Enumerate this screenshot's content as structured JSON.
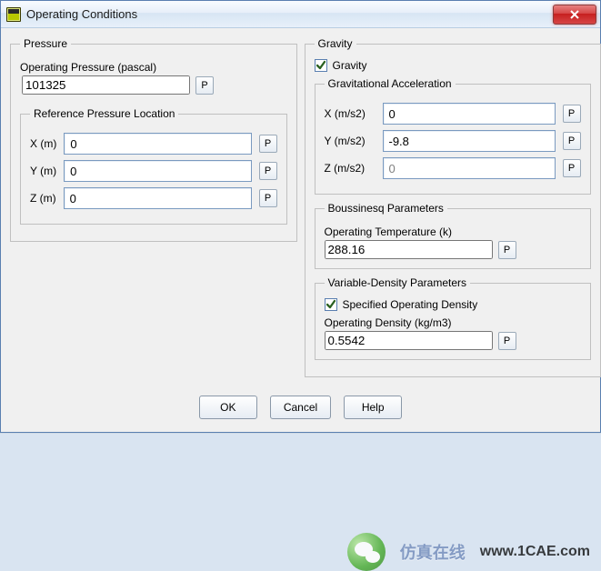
{
  "window": {
    "title": "Operating Conditions",
    "close_x": "×"
  },
  "pressure": {
    "legend": "Pressure",
    "op_pressure_label": "Operating Pressure (pascal)",
    "op_pressure_value": "101325",
    "ref_loc_legend": "Reference Pressure Location",
    "x_label": "X (m)",
    "x_value": "0",
    "y_label": "Y (m)",
    "y_value": "0",
    "z_label": "Z (m)",
    "z_value": "0"
  },
  "gravity": {
    "legend": "Gravity",
    "checkbox_label": "Gravity",
    "checked": true,
    "accel_legend": "Gravitational Acceleration",
    "x_label": "X (m/s2)",
    "x_value": "0",
    "y_label": "Y (m/s2)",
    "y_value": "-9.8",
    "z_label": "Z (m/s2)",
    "z_value": "0"
  },
  "boussinesq": {
    "legend": "Boussinesq Parameters",
    "temp_label": "Operating Temperature (k)",
    "temp_value": "288.16"
  },
  "vardensity": {
    "legend": "Variable-Density Parameters",
    "checkbox_label": "Specified Operating Density",
    "checked": true,
    "density_label": "Operating Density (kg/m3)",
    "density_value": "0.5542"
  },
  "buttons": {
    "ok": "OK",
    "cancel": "Cancel",
    "help": "Help"
  },
  "p_label": "P",
  "branding": {
    "brand": "仿真在线",
    "url": "www.1CAE.com"
  }
}
